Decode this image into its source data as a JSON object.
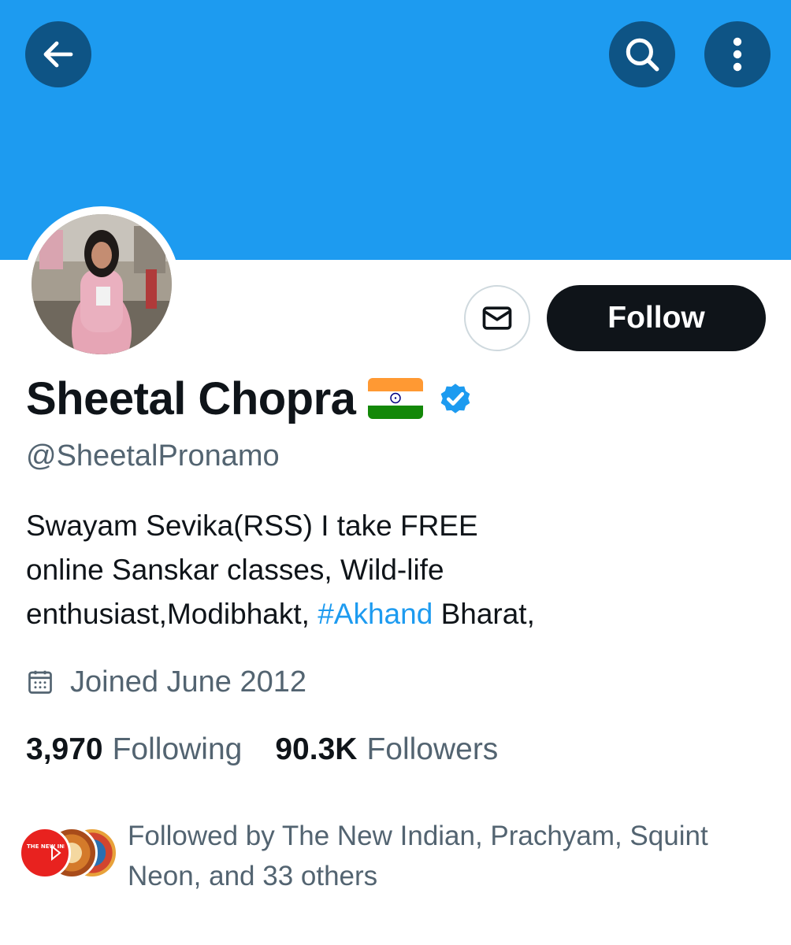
{
  "header": {
    "back_icon": "arrow-left-icon",
    "search_icon": "search-icon",
    "more_icon": "more-vertical-icon",
    "banner_color": "#1d9bf0",
    "button_color": "#0e5485"
  },
  "profile": {
    "name": "Sheetal Chopra",
    "flag_icon": "india-flag-icon",
    "verified_icon": "verified-badge-icon",
    "handle": "@SheetalPronamo",
    "bio_lines": [
      "Swayam Sevika(RSS) I take FREE",
      "online Sanskar classes, Wild-life",
      "enthusiast,Modibhakt, "
    ],
    "bio_hashtag": "#Akhand",
    "bio_end": " Bharat,",
    "joined": "Joined June 2012"
  },
  "actions": {
    "message_icon": "envelope-icon",
    "follow_label": "Follow"
  },
  "stats": {
    "following_count": "3,970",
    "following_label": "Following",
    "followers_count": "90.3K",
    "followers_label": "Followers"
  },
  "followed_by": {
    "text_line1": "Followed by The New Indian, Prachyam, Squint",
    "text_line2": "Neon, and 33 others",
    "avatar_logo_text": "THE NEW INDIAN"
  },
  "colors": {
    "text_primary": "#0f1419",
    "text_secondary": "#536471",
    "link": "#1d9bf0"
  }
}
